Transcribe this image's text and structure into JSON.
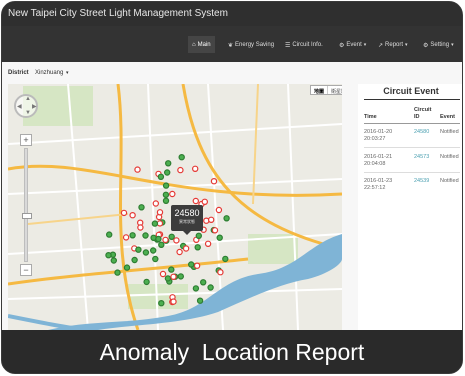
{
  "app": {
    "title": "New Taipei City Street Light Management System"
  },
  "nav": [
    {
      "icon": "home-icon",
      "glyph": "⌂",
      "label": "Main",
      "caret": false,
      "active": true
    },
    {
      "icon": "leaf-icon",
      "glyph": "❦",
      "label": "Energy Saving",
      "caret": false,
      "active": false
    },
    {
      "icon": "circuit-icon",
      "glyph": "☰",
      "label": "Circuit Info.",
      "caret": false,
      "active": false
    },
    {
      "icon": "gear-icon",
      "glyph": "⚙",
      "label": "Event",
      "caret": true,
      "active": false
    },
    {
      "icon": "chart-icon",
      "glyph": "↗",
      "label": "Report",
      "caret": true,
      "active": false
    },
    {
      "icon": "gear-icon",
      "glyph": "⚙",
      "label": "Setting",
      "caret": true,
      "active": false
    }
  ],
  "district": {
    "label": "District",
    "value": "Xinzhuang"
  },
  "map": {
    "type_buttons": [
      "地圖",
      "衛星影像"
    ],
    "selected_type": "地圖",
    "tooltip": {
      "id": "24580",
      "sub": "異常狀態"
    },
    "marker_colors": {
      "normal": "#4caf50",
      "alert": "#e53935"
    },
    "river_color": "#7fb4d6",
    "highway_color": "#f5b942"
  },
  "circuit_event": {
    "title": "Circuit Event",
    "headers": {
      "time": "Time",
      "circuit_top": "Circuit",
      "circuit_bottom": "ID",
      "event": "Event"
    },
    "rows": [
      {
        "date": "2016-01-20",
        "time": "20:03:27",
        "id": "24580",
        "event": "Notified"
      },
      {
        "date": "2016-01-21",
        "time": "20:04:08",
        "id": "24573",
        "event": "Notified"
      },
      {
        "date": "2016-01-23",
        "time": "22:57:12",
        "id": "24539",
        "event": "Notified"
      }
    ]
  },
  "caption": "Anomaly  Location Report"
}
